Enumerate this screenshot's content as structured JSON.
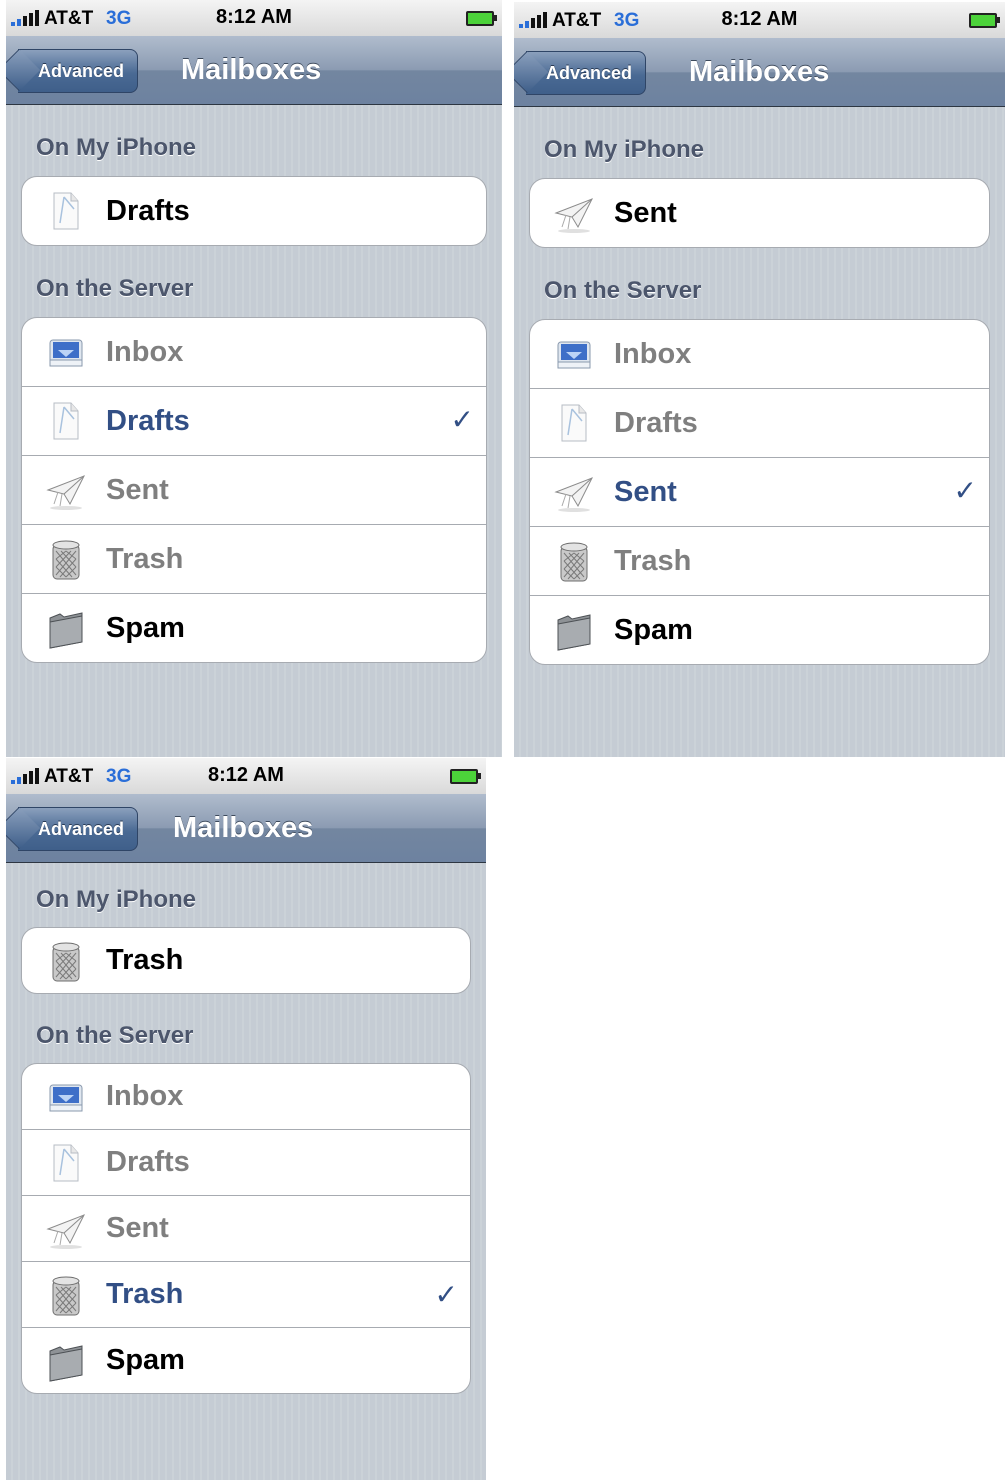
{
  "screens": [
    {
      "status": {
        "carrier": "AT&T",
        "network": "3G",
        "time": "8:12 AM"
      },
      "nav": {
        "back": "Advanced",
        "title": "Mailboxes"
      },
      "section_phone": "On My iPhone",
      "phone_item": {
        "label": "Drafts",
        "icon": "drafts-icon"
      },
      "section_server": "On the Server",
      "server_items": [
        {
          "label": "Inbox",
          "icon": "inbox-icon",
          "state": "disabled"
        },
        {
          "label": "Drafts",
          "icon": "drafts-icon",
          "state": "selected"
        },
        {
          "label": "Sent",
          "icon": "sent-icon",
          "state": "disabled"
        },
        {
          "label": "Trash",
          "icon": "trash-icon",
          "state": "disabled"
        },
        {
          "label": "Spam",
          "icon": "folder-icon",
          "state": "normal"
        }
      ],
      "checkmark": "✓"
    },
    {
      "status": {
        "carrier": "AT&T",
        "network": "3G",
        "time": "8:12 AM"
      },
      "nav": {
        "back": "Advanced",
        "title": "Mailboxes"
      },
      "section_phone": "On My iPhone",
      "phone_item": {
        "label": "Sent",
        "icon": "sent-icon"
      },
      "section_server": "On the Server",
      "server_items": [
        {
          "label": "Inbox",
          "icon": "inbox-icon",
          "state": "disabled"
        },
        {
          "label": "Drafts",
          "icon": "drafts-icon",
          "state": "disabled"
        },
        {
          "label": "Sent",
          "icon": "sent-icon",
          "state": "selected"
        },
        {
          "label": "Trash",
          "icon": "trash-icon",
          "state": "disabled"
        },
        {
          "label": "Spam",
          "icon": "folder-icon",
          "state": "normal"
        }
      ],
      "checkmark": "✓"
    },
    {
      "status": {
        "carrier": "AT&T",
        "network": "3G",
        "time": "8:12 AM"
      },
      "nav": {
        "back": "Advanced",
        "title": "Mailboxes"
      },
      "section_phone": "On My iPhone",
      "phone_item": {
        "label": "Trash",
        "icon": "trash-icon"
      },
      "section_server": "On the Server",
      "server_items": [
        {
          "label": "Inbox",
          "icon": "inbox-icon",
          "state": "disabled"
        },
        {
          "label": "Drafts",
          "icon": "drafts-icon",
          "state": "disabled"
        },
        {
          "label": "Sent",
          "icon": "sent-icon",
          "state": "disabled"
        },
        {
          "label": "Trash",
          "icon": "trash-icon",
          "state": "selected"
        },
        {
          "label": "Spam",
          "icon": "folder-icon",
          "state": "normal"
        }
      ],
      "checkmark": "✓"
    }
  ]
}
